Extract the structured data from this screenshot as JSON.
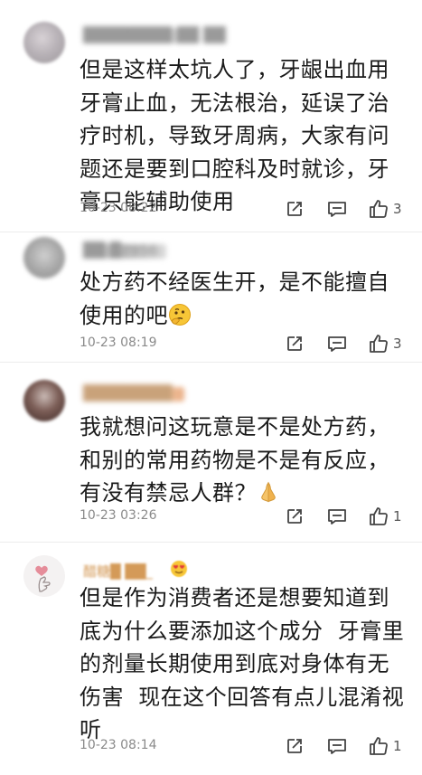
{
  "comments": [
    {
      "username": "████████ ██ ██",
      "text": "但是这样太坑人了，牙龈出血用牙膏止血，无法根治，延误了治疗时机，导致牙周病，大家有问题还是要到口腔科及时就诊，牙膏只能辅助使用",
      "time": "10-23 08:22",
      "likes": "3"
    },
    {
      "username": "██ █7956",
      "text": "处方药不经医生开，是不能擅自使用的吧",
      "emoji": "thinking-face",
      "time": "10-23 08:19",
      "likes": "3"
    },
    {
      "username": "████████",
      "text": "我就想问这玩意是不是处方药，和别的常用药物是不是有反应，有没有禁忌人群？",
      "emoji": "folded-hands",
      "time": "10-23 03:26",
      "likes": "1"
    },
    {
      "username": "醋糖█ ██_",
      "text": "但是作为消费者还是想要知道到底为什么要添加这个成分  牙膏里的剂量长期使用到底对身体有无伤害  现在这个回答有点儿混淆视听",
      "time": "10-23 08:14",
      "likes": "1"
    }
  ]
}
